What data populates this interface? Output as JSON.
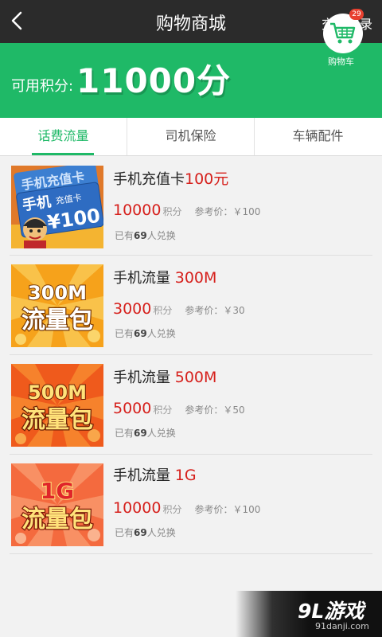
{
  "topbar": {
    "title": "购物商城",
    "records_label": "交易记录"
  },
  "banner": {
    "points_label": "可用积分:",
    "points_value": "11000分",
    "cart_badge": "29",
    "cart_label": "购物车"
  },
  "tabs": [
    {
      "label": "话费流量",
      "active": true
    },
    {
      "label": "司机保险",
      "active": false
    },
    {
      "label": "车辆配件",
      "active": false
    }
  ],
  "items": [
    {
      "name": "手机充值卡",
      "amount": "100元",
      "points": "10000",
      "points_unit": "积分",
      "ref_price": "参考价：￥100",
      "redeem_prefix": "已有",
      "redeem_count": "69",
      "redeem_suffix": "人兑换",
      "image": {
        "type": "card",
        "texts": [
          "手机充值卡",
          "手机",
          "充值卡",
          "¥100"
        ]
      }
    },
    {
      "name": "手机流量",
      "amount": "300M",
      "points": "3000",
      "points_unit": "积分",
      "ref_price": "参考价：￥30",
      "redeem_prefix": "已有",
      "redeem_count": "69",
      "redeem_suffix": "人兑换",
      "image": {
        "type": "flow",
        "texts": [
          "300M",
          "流量包"
        ],
        "bg": "#f6a21b",
        "ray": "#f9c24a"
      }
    },
    {
      "name": "手机流量",
      "amount": "500M",
      "points": "5000",
      "points_unit": "积分",
      "ref_price": "参考价：￥50",
      "redeem_prefix": "已有",
      "redeem_count": "69",
      "redeem_suffix": "人兑换",
      "image": {
        "type": "flow",
        "texts": [
          "500M",
          "流量包"
        ],
        "bg": "#ef5a1c",
        "ray": "#f6822c"
      }
    },
    {
      "name": "手机流量",
      "amount": "1G",
      "points": "10000",
      "points_unit": "积分",
      "ref_price": "参考价：￥100",
      "redeem_prefix": "已有",
      "redeem_count": "69",
      "redeem_suffix": "人兑换",
      "image": {
        "type": "flow",
        "texts": [
          "1G",
          "流量包"
        ],
        "bg": "#f46a3e",
        "ray": "#f89064"
      }
    }
  ],
  "watermark": {
    "logo": "9L游戏",
    "url": "91danji.com"
  }
}
